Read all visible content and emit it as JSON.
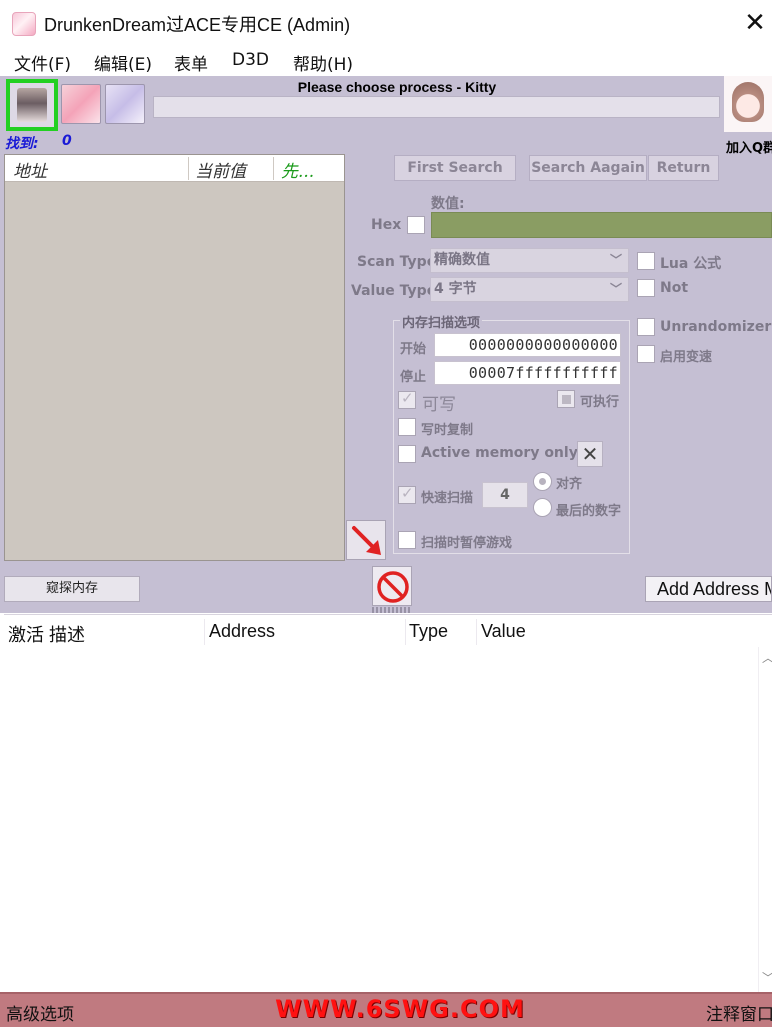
{
  "window": {
    "title": "DrunkenDream过ACE专用CE (Admin)",
    "close_glyph": "✕"
  },
  "menu": [
    "文件(F)",
    "编辑(E)",
    "表单",
    "D3D",
    "帮助(H)"
  ],
  "toolbar": {
    "process_title": "Please choose process - Kitty",
    "join_label": "加入Q群",
    "icons": [
      "select-process-icon",
      "open-table-icon",
      "save-table-icon",
      "mascot-image"
    ]
  },
  "found": {
    "label": "找到:",
    "count": "0"
  },
  "results_list": {
    "columns": [
      "地址",
      "当前值",
      "先..."
    ]
  },
  "scan": {
    "first_search": "First Search",
    "search_again": "Search Aagain",
    "return": "Return",
    "value_label": "数值:",
    "hex_label": "Hex",
    "scan_type_label": "Scan Type",
    "scan_type_value": "精确数值",
    "value_type_label": "Value Type",
    "value_type_value": "4 字节",
    "lua_label": "Lua 公式",
    "not_label": "Not",
    "unrandomizer_label": "Unrandomizer",
    "speedhack_label": "启用变速"
  },
  "memory_options": {
    "title": "内存扫描选项",
    "start_label": "开始",
    "start_value": "0000000000000000",
    "stop_label": "停止",
    "stop_value": "00007fffffffffff",
    "writable_label": "可写",
    "executable_label": "可执行",
    "copy_on_write_label": "写时复制",
    "active_memory_label": "Active memory only",
    "fast_scan_label": "快速扫描",
    "fast_scan_value": "4",
    "align_label": "对齐",
    "last_digits_label": "最后的数字",
    "pause_game_label": "扫描时暂停游戏"
  },
  "buttons": {
    "probe_memory": "窥探内存",
    "add_address": "Add Address Manually"
  },
  "address_table": {
    "columns": [
      "激活 描述",
      "Address",
      "Type",
      "Value"
    ]
  },
  "statusbar": {
    "advanced_options": "高级选项",
    "banner": "WWW.6SWG.COM",
    "comment_window": "注释窗口"
  },
  "colors": {
    "panel": "#c5bfd3",
    "value_input": "#8a9d63",
    "statusbar": "#c07a80",
    "banner_text": "#ff1111",
    "found_text": "#1a1ad6",
    "selected_border": "#22d022"
  }
}
